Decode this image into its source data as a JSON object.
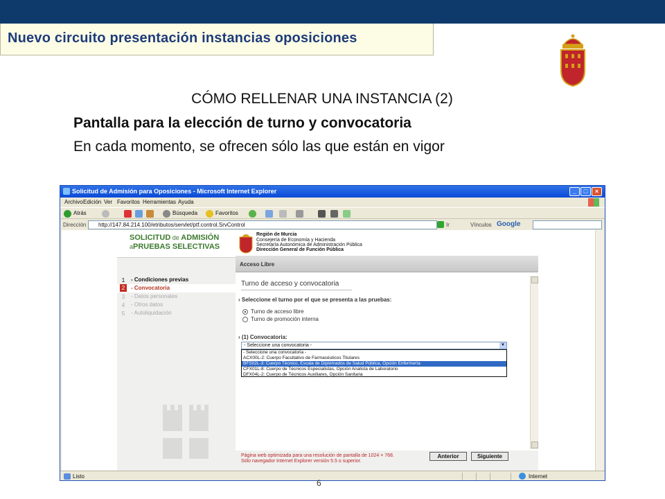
{
  "slide": {
    "title": "Nuevo circuito presentación instancias oposiciones",
    "heading": "CÓMO RELLENAR UNA INSTANCIA (2)",
    "subheading": "Pantalla para la elección de turno y convocatoria",
    "description": "En cada momento, se ofrecen sólo las que están en vigor",
    "page_number": "6",
    "colors": {
      "top_bar": "#0d3a6b",
      "title_text": "#1d3b7a",
      "crest_red": "#c0252b",
      "crest_gold": "#d4a017"
    }
  },
  "browser": {
    "window_title": "Solicitud de Admisión para Oposiciones - Microsoft Internet Explorer",
    "menu": [
      "Archivo",
      "Edición",
      "Ver",
      "Favoritos",
      "Herramientas",
      "Ayuda"
    ],
    "toolbar": {
      "back": "Atrás",
      "search": "Búsqueda",
      "favorites": "Favoritos"
    },
    "address_label": "Dirección",
    "address_value": "http://147.84.214.100/etributos/servlet/ptf.control.SrvControl",
    "go_label": "Ir",
    "links_label": "Vínculos",
    "google_label": "Google",
    "status_left": "Listo",
    "status_right": "Internet"
  },
  "webpage": {
    "logo_line1": {
      "a": "SOLICITUD",
      "b": " de ",
      "c": "ADMISIÓN"
    },
    "logo_line2": {
      "a": "a",
      "b": "PRUEBAS SELECTIVAS"
    },
    "header": {
      "l1": "Región de Murcia",
      "l2": "Consejería de Economía y Hacienda",
      "l3": "Secretaría Autonómica de Administración Pública",
      "l4": "Dirección General de Función Pública"
    },
    "section_bar": "Acceso Libre",
    "steps": [
      {
        "num": "1",
        "label": "Condiciones previas"
      },
      {
        "num": "2",
        "label": "Convocatoria"
      },
      {
        "num": "3",
        "label": "Datos personales"
      },
      {
        "num": "4",
        "label": "Otros datos"
      },
      {
        "num": "5",
        "label": "Autoliquidación"
      }
    ],
    "form": {
      "title": "Turno de acceso y convocatoria",
      "turn_question": "Seleccione el turno por el que se presenta a las pruebas:",
      "turn_options": [
        "Turno de acceso libre",
        "Turno de promoción interna"
      ],
      "selected_turn": "Turno de acceso libre",
      "convocatoria_label": "(1) Convocatoria:",
      "select_value": "- Seleccione una convocatoria -",
      "options": [
        "- Seleccione una convocatoria -",
        "ACX00L-2: Cuerpo Facultativo de Farmacéuticos Titulares",
        "BFS02L-3: Cuerpo Técnico, Escala de Diplomados de Salud Pública, Opción Enfermería",
        "CFX01L-8: Cuerpo de Técnicos Especialistas, Opción Analista de Laboratorio",
        "DFX04L-2: Cuerpo de Técnicos Auxiliares, Opción Sanitaria"
      ],
      "highlighted_option": "BFS02L-3: Cuerpo Técnico, Escala de Diplomados de Salud Pública, Opción Enfermería"
    },
    "footnote_1": "Página web optimizada para una resolución de pantalla de 1024 × 768.",
    "footnote_2": "Sólo navegador Internet Explorer versión 5.5 o superior.",
    "prev_button": "Anterior",
    "next_button": "Siguiente"
  }
}
